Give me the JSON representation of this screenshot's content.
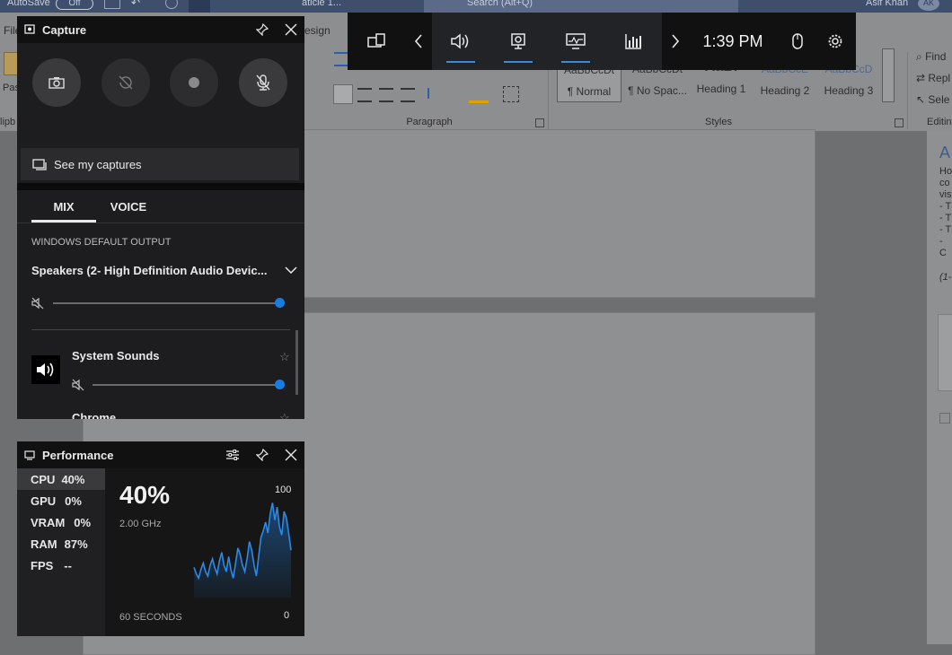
{
  "word": {
    "title_left": "AutoSave",
    "toggle": "Off",
    "title_doc": "aticle 1...",
    "search": "Search (Alt+Q)",
    "user": "Asif Khan",
    "user_initials": "AK",
    "tab_partial_file": "File",
    "tab_partial_design": "esign",
    "group_paragraph": "Paragraph",
    "group_styles": "Styles",
    "group_editing": "Editing",
    "group_clipboard": "lipb",
    "paste": "Pas",
    "styles": [
      {
        "preview": "AaBbCcDt",
        "name": "¶ Normal"
      },
      {
        "preview": "AaBbCcDt",
        "name": "¶ No Spac..."
      },
      {
        "preview": "AaBl",
        "name": "Heading 1"
      },
      {
        "preview": "AaBbCcE",
        "name": "Heading 2"
      },
      {
        "preview": "AaBbCcD",
        "name": "Heading 3"
      }
    ],
    "find": "Find",
    "replace": "Repl",
    "select": "Sele",
    "side_pane_lines": [
      "A",
      "Ho",
      "co",
      "vis",
      "- T",
      "- T",
      "- T",
      "- C",
      "(1-"
    ]
  },
  "gamebar": {
    "time": "1:39 PM"
  },
  "capture": {
    "title": "Capture",
    "see_captures": "See my captures"
  },
  "audio": {
    "tabs": [
      "MIX",
      "VOICE"
    ],
    "section_label": "WINDOWS DEFAULT OUTPUT",
    "device": "Speakers (2- High Definition Audio Devic...",
    "master_level": 1.0,
    "apps": [
      {
        "name": "System Sounds",
        "level": 1.0
      },
      {
        "name": "Chrome"
      }
    ]
  },
  "performance": {
    "title": "Performance",
    "metrics": [
      {
        "label": "CPU",
        "value": "40%"
      },
      {
        "label": "GPU",
        "value": "0%"
      },
      {
        "label": "VRAM",
        "value": "0%"
      },
      {
        "label": "RAM",
        "value": "87%"
      },
      {
        "label": "FPS",
        "value": "--"
      }
    ],
    "big_value": "40%",
    "freq": "2.00 GHz",
    "max_label": "100",
    "min_label": "0",
    "time_label": "60 SECONDS",
    "cpu_history": [
      28,
      22,
      18,
      26,
      32,
      24,
      20,
      30,
      36,
      28,
      22,
      34,
      42,
      30,
      24,
      38,
      26,
      18,
      32,
      46,
      40,
      30,
      24,
      36,
      52,
      44,
      30,
      20,
      38,
      56,
      62,
      70,
      60,
      78,
      88,
      72,
      84,
      66,
      58,
      80,
      74,
      60,
      44
    ]
  },
  "colors": {
    "accent": "#1a7be0",
    "gamebar_bg": "#111111",
    "widget_bg": "#1d1d1f"
  }
}
